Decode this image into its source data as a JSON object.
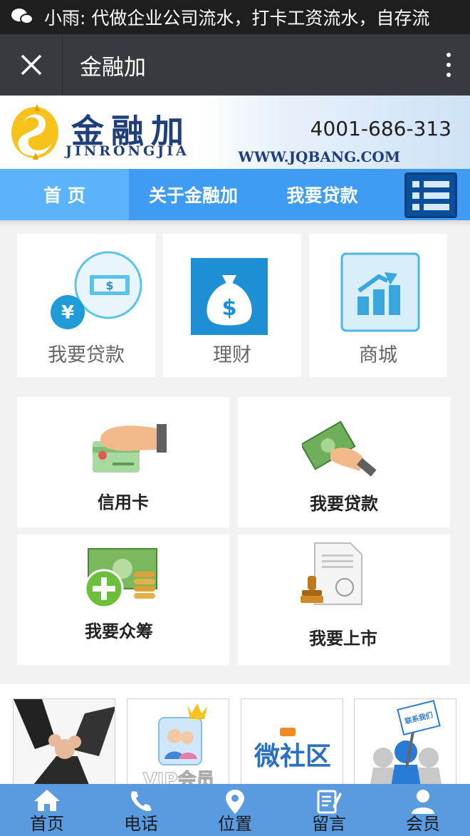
{
  "notification": {
    "text": "小雨: 代做企业公司流水，打卡工资流水，自存流"
  },
  "titlebar": {
    "title": "金融加"
  },
  "banner": {
    "brand_cn": "金融加",
    "brand_en": "JINRONGJIA",
    "phone": "4001-686-313",
    "url": "WWW.JQBANG.COM"
  },
  "nav": {
    "items": [
      "首 页",
      "关于金融加",
      "我要贷款"
    ]
  },
  "tiles_top": [
    {
      "label": "我要贷款",
      "icon": "loan-money-icon"
    },
    {
      "label": "理财",
      "icon": "money-bag-icon"
    },
    {
      "label": "商城",
      "icon": "chart-growth-icon"
    }
  ],
  "tiles_grid": [
    {
      "label": "信用卡",
      "icon": "credit-card-hand-icon"
    },
    {
      "label": "我要贷款",
      "icon": "cash-hand-icon"
    },
    {
      "label": "我要众筹",
      "icon": "crowdfunding-cash-icon"
    },
    {
      "label": "我要上市",
      "icon": "document-stamp-icon"
    }
  ],
  "thumbnails": [
    {
      "name": "teamwork-hands"
    },
    {
      "name": "vip-member",
      "text": "VIP会员"
    },
    {
      "name": "micro-community",
      "text": "微社区"
    },
    {
      "name": "contact-us",
      "text": "联系我们"
    }
  ],
  "bottom_nav": [
    {
      "label": "首页",
      "icon": "home-icon"
    },
    {
      "label": "电话",
      "icon": "phone-icon"
    },
    {
      "label": "位置",
      "icon": "location-pin-icon"
    },
    {
      "label": "留言",
      "icon": "message-edit-icon"
    },
    {
      "label": "会员",
      "icon": "user-icon"
    }
  ],
  "colors": {
    "nav_bg": "#3f9cf2",
    "nav_active": "#5ab3fb",
    "bottom_bar": "#5a9be0",
    "title_bar": "#393a3f"
  }
}
